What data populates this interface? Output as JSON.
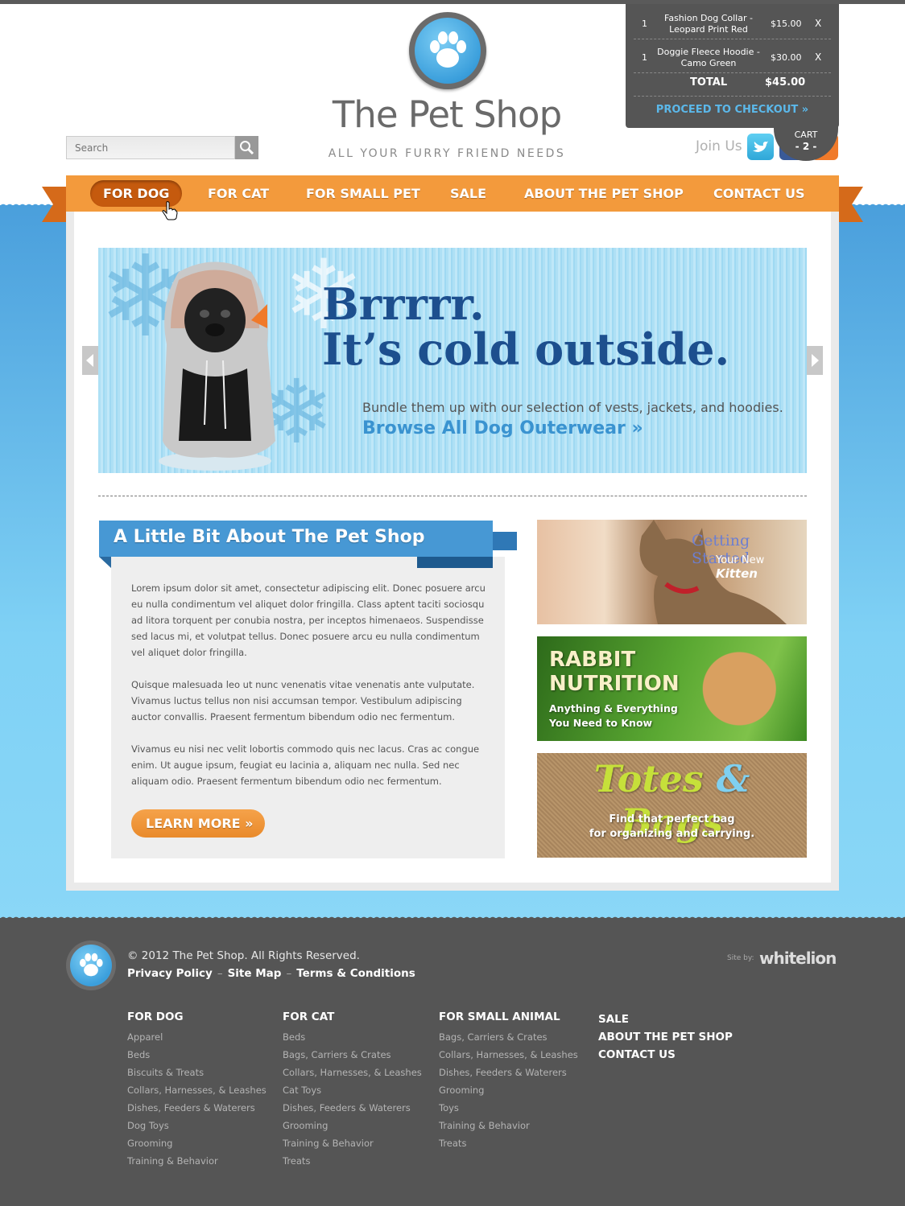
{
  "header": {
    "logo_title": "The Pet Shop",
    "tagline": "ALL YOUR FURRY FRIEND NEEDS",
    "search_placeholder": "Search",
    "join_us": "Join Us"
  },
  "cart": {
    "items": [
      {
        "qty": "1",
        "name": "Fashion Dog Collar - Leopard Print Red",
        "price": "$15.00",
        "remove": "X"
      },
      {
        "qty": "1",
        "name": "Doggie Fleece Hoodie - Camo Green",
        "price": "$30.00",
        "remove": "X"
      }
    ],
    "total_label": "TOTAL",
    "total_value": "$45.00",
    "checkout_label": "PROCEED TO CHECKOUT »",
    "tab_label": "CART",
    "tab_count": "- 2 -"
  },
  "nav": {
    "items": [
      "FOR DOG",
      "FOR CAT",
      "FOR SMALL PET",
      "SALE",
      "ABOUT THE PET SHOP",
      "CONTACT US"
    ],
    "active_index": 0
  },
  "hero": {
    "headline_line1": "Brrrrr.",
    "headline_line2": "It’s cold outside.",
    "subtext": "Bundle them up with our selection of vests, jackets, and hoodies.",
    "link": "Browse All Dog Outerwear »"
  },
  "about": {
    "title": "A Little Bit About The Pet Shop",
    "paragraphs": [
      "Lorem ipsum dolor sit amet, consectetur adipiscing elit. Donec posuere arcu eu nulla condimentum vel aliquet dolor fringilla. Class aptent taciti sociosqu ad litora torquent per conubia nostra, per inceptos himenaeos. Suspendisse sed lacus mi, et volutpat tellus. Donec posuere arcu eu nulla condimentum vel aliquet dolor fringilla.",
      "Quisque malesuada leo ut nunc venenatis vitae venenatis ante vulputate. Vivamus luctus tellus non nisi accumsan tempor. Vestibulum adipiscing auctor convallis. Praesent fermentum bibendum odio nec fermentum.",
      "Vivamus eu nisi nec velit lobortis commodo quis nec lacus. Cras ac congue enim. Ut augue ipsum, feugiat eu lacinia a, aliquam nec nulla. Sed nec aliquam odio. Praesent fermentum bibendum odio nec fermentum."
    ],
    "button": "LEARN MORE »"
  },
  "promos": {
    "kitten": {
      "line1": "Getting Started",
      "line2_prefix": "Your New",
      "line2_em": "Kitten"
    },
    "rabbit": {
      "line1": "RABBIT",
      "line2": "NUTRITION",
      "line3": "Anything & Everything",
      "line4": "You Need to Know"
    },
    "bags": {
      "title_a": "Totes",
      "title_amp": "&",
      "title_b": "Bags",
      "line1": "Find that perfect bag",
      "line2": "for organizing and carrying."
    }
  },
  "footer": {
    "copyright": "© 2012 The Pet Shop. All Rights Reserved.",
    "links": [
      "Privacy Policy",
      "Site Map",
      "Terms & Conditions"
    ],
    "site_by": "Site by:",
    "agency": "whitelion",
    "columns": [
      {
        "title": "FOR DOG",
        "items": [
          "Apparel",
          "Beds",
          "Biscuits & Treats",
          "Collars, Harnesses, & Leashes",
          "Dishes, Feeders & Waterers",
          "Dog Toys",
          "Grooming",
          "Training & Behavior"
        ]
      },
      {
        "title": "FOR CAT",
        "items": [
          "Beds",
          "Bags, Carriers & Crates",
          "Collars, Harnesses, & Leashes",
          "Cat Toys",
          "Dishes, Feeders & Waterers",
          "Grooming",
          "Training & Behavior",
          "Treats"
        ]
      },
      {
        "title": "FOR SMALL ANIMAL",
        "items": [
          "Bags, Carriers & Crates",
          "Collars, Harnesses, & Leashes",
          "Dishes, Feeders & Waterers",
          "Grooming",
          "Toys",
          "Training & Behavior",
          "Treats"
        ]
      }
    ],
    "main_links": [
      "SALE",
      "ABOUT THE PET SHOP",
      "CONTACT US"
    ]
  },
  "colors": {
    "accent_orange": "#f39a3c",
    "accent_blue": "#4798d4",
    "footer_gray": "#555555"
  }
}
